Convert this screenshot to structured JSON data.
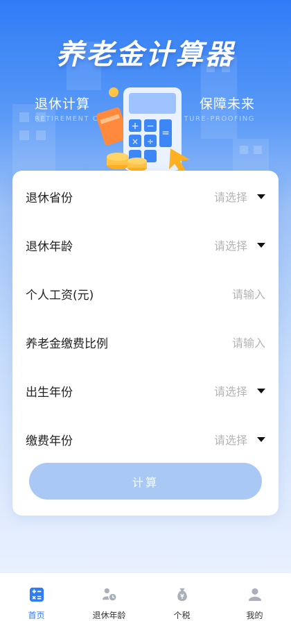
{
  "hero": {
    "title": "养老金计算器",
    "slogan_left": "退休计算",
    "slogan_right": "保障未来",
    "slogan_left_en": "RETIREMENT CA",
    "slogan_right_en": "TURE-PROOFING"
  },
  "form": {
    "rows": [
      {
        "label": "退休省份",
        "value": "请选择",
        "type": "select"
      },
      {
        "label": "退休年龄",
        "value": "请选择",
        "type": "select"
      },
      {
        "label": "个人工资(元)",
        "value": "请输入",
        "type": "input"
      },
      {
        "label": "养老金缴费比例",
        "value": "请输入",
        "type": "input"
      },
      {
        "label": "出生年份",
        "value": "请选择",
        "type": "select"
      },
      {
        "label": "缴费年份",
        "value": "请选择",
        "type": "select"
      }
    ],
    "submit_label": "计算"
  },
  "tabbar": {
    "items": [
      {
        "label": "首页",
        "icon": "calculator-icon",
        "active": true
      },
      {
        "label": "退休年龄",
        "icon": "people-clock-icon",
        "active": false
      },
      {
        "label": "个税",
        "icon": "money-bag-icon",
        "active": false
      },
      {
        "label": "我的",
        "icon": "user-icon",
        "active": false
      }
    ]
  },
  "colors": {
    "primary": "#2f7cf6",
    "button_disabled": "#a9c8f3",
    "placeholder": "#b4b4b4",
    "tab_inactive_icon": "#a9b0ba"
  }
}
